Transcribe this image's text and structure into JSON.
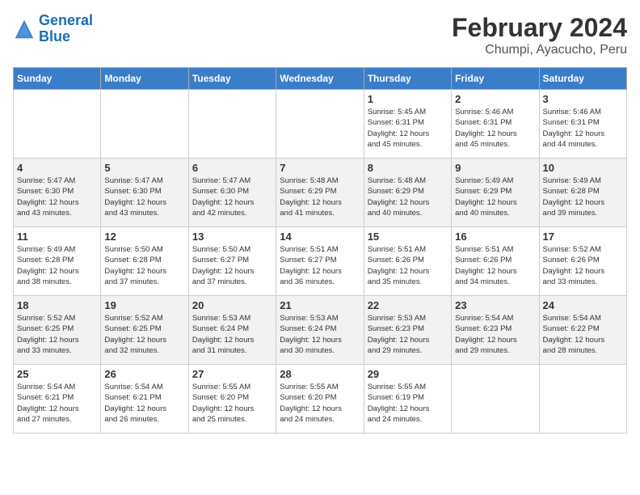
{
  "header": {
    "logo_line1": "General",
    "logo_line2": "Blue",
    "main_title": "February 2024",
    "subtitle": "Chumpi, Ayacucho, Peru"
  },
  "days_of_week": [
    "Sunday",
    "Monday",
    "Tuesday",
    "Wednesday",
    "Thursday",
    "Friday",
    "Saturday"
  ],
  "weeks": [
    [
      {
        "num": "",
        "info": ""
      },
      {
        "num": "",
        "info": ""
      },
      {
        "num": "",
        "info": ""
      },
      {
        "num": "",
        "info": ""
      },
      {
        "num": "1",
        "info": "Sunrise: 5:45 AM\nSunset: 6:31 PM\nDaylight: 12 hours\nand 45 minutes."
      },
      {
        "num": "2",
        "info": "Sunrise: 5:46 AM\nSunset: 6:31 PM\nDaylight: 12 hours\nand 45 minutes."
      },
      {
        "num": "3",
        "info": "Sunrise: 5:46 AM\nSunset: 6:31 PM\nDaylight: 12 hours\nand 44 minutes."
      }
    ],
    [
      {
        "num": "4",
        "info": "Sunrise: 5:47 AM\nSunset: 6:30 PM\nDaylight: 12 hours\nand 43 minutes."
      },
      {
        "num": "5",
        "info": "Sunrise: 5:47 AM\nSunset: 6:30 PM\nDaylight: 12 hours\nand 43 minutes."
      },
      {
        "num": "6",
        "info": "Sunrise: 5:47 AM\nSunset: 6:30 PM\nDaylight: 12 hours\nand 42 minutes."
      },
      {
        "num": "7",
        "info": "Sunrise: 5:48 AM\nSunset: 6:29 PM\nDaylight: 12 hours\nand 41 minutes."
      },
      {
        "num": "8",
        "info": "Sunrise: 5:48 AM\nSunset: 6:29 PM\nDaylight: 12 hours\nand 40 minutes."
      },
      {
        "num": "9",
        "info": "Sunrise: 5:49 AM\nSunset: 6:29 PM\nDaylight: 12 hours\nand 40 minutes."
      },
      {
        "num": "10",
        "info": "Sunrise: 5:49 AM\nSunset: 6:28 PM\nDaylight: 12 hours\nand 39 minutes."
      }
    ],
    [
      {
        "num": "11",
        "info": "Sunrise: 5:49 AM\nSunset: 6:28 PM\nDaylight: 12 hours\nand 38 minutes."
      },
      {
        "num": "12",
        "info": "Sunrise: 5:50 AM\nSunset: 6:28 PM\nDaylight: 12 hours\nand 37 minutes."
      },
      {
        "num": "13",
        "info": "Sunrise: 5:50 AM\nSunset: 6:27 PM\nDaylight: 12 hours\nand 37 minutes."
      },
      {
        "num": "14",
        "info": "Sunrise: 5:51 AM\nSunset: 6:27 PM\nDaylight: 12 hours\nand 36 minutes."
      },
      {
        "num": "15",
        "info": "Sunrise: 5:51 AM\nSunset: 6:26 PM\nDaylight: 12 hours\nand 35 minutes."
      },
      {
        "num": "16",
        "info": "Sunrise: 5:51 AM\nSunset: 6:26 PM\nDaylight: 12 hours\nand 34 minutes."
      },
      {
        "num": "17",
        "info": "Sunrise: 5:52 AM\nSunset: 6:26 PM\nDaylight: 12 hours\nand 33 minutes."
      }
    ],
    [
      {
        "num": "18",
        "info": "Sunrise: 5:52 AM\nSunset: 6:25 PM\nDaylight: 12 hours\nand 33 minutes."
      },
      {
        "num": "19",
        "info": "Sunrise: 5:52 AM\nSunset: 6:25 PM\nDaylight: 12 hours\nand 32 minutes."
      },
      {
        "num": "20",
        "info": "Sunrise: 5:53 AM\nSunset: 6:24 PM\nDaylight: 12 hours\nand 31 minutes."
      },
      {
        "num": "21",
        "info": "Sunrise: 5:53 AM\nSunset: 6:24 PM\nDaylight: 12 hours\nand 30 minutes."
      },
      {
        "num": "22",
        "info": "Sunrise: 5:53 AM\nSunset: 6:23 PM\nDaylight: 12 hours\nand 29 minutes."
      },
      {
        "num": "23",
        "info": "Sunrise: 5:54 AM\nSunset: 6:23 PM\nDaylight: 12 hours\nand 29 minutes."
      },
      {
        "num": "24",
        "info": "Sunrise: 5:54 AM\nSunset: 6:22 PM\nDaylight: 12 hours\nand 28 minutes."
      }
    ],
    [
      {
        "num": "25",
        "info": "Sunrise: 5:54 AM\nSunset: 6:21 PM\nDaylight: 12 hours\nand 27 minutes."
      },
      {
        "num": "26",
        "info": "Sunrise: 5:54 AM\nSunset: 6:21 PM\nDaylight: 12 hours\nand 26 minutes."
      },
      {
        "num": "27",
        "info": "Sunrise: 5:55 AM\nSunset: 6:20 PM\nDaylight: 12 hours\nand 25 minutes."
      },
      {
        "num": "28",
        "info": "Sunrise: 5:55 AM\nSunset: 6:20 PM\nDaylight: 12 hours\nand 24 minutes."
      },
      {
        "num": "29",
        "info": "Sunrise: 5:55 AM\nSunset: 6:19 PM\nDaylight: 12 hours\nand 24 minutes."
      },
      {
        "num": "",
        "info": ""
      },
      {
        "num": "",
        "info": ""
      }
    ]
  ]
}
